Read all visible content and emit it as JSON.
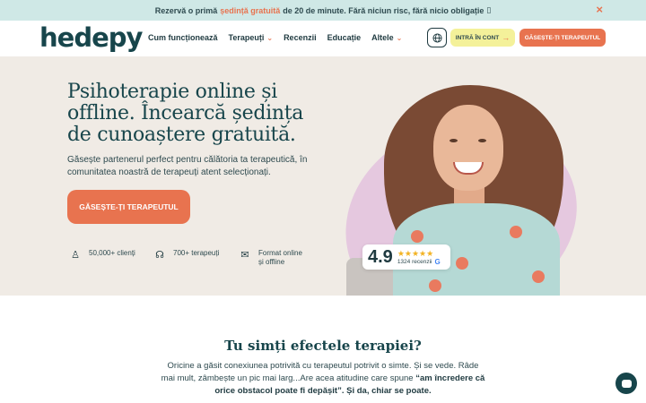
{
  "promo": {
    "text_before": "Rezervă o primă",
    "highlight": "ședință gratuită",
    "text_after": "de 20 de minute. Fără niciun risc, fără nicio obligație",
    "trailing_glyph": "▯",
    "close_symbol": "×"
  },
  "header": {
    "logo": "hedepy",
    "nav": [
      {
        "label": "Cum funcționează",
        "has_dropdown": false
      },
      {
        "label": "Terapeuți",
        "has_dropdown": true
      },
      {
        "label": "Recenzii",
        "has_dropdown": false
      },
      {
        "label": "Educație",
        "has_dropdown": false
      },
      {
        "label": "Altele",
        "has_dropdown": true
      }
    ],
    "globe_icon": "globe-icon",
    "login_label": "INTRĂ ÎN CONT",
    "login_arrow": "→",
    "cta_label": "GĂSEȘTE-ȚI TERAPEUTUL"
  },
  "hero": {
    "title": "Psihoterapie online și offline. Încearcă ședința de cunoaștere gratuită.",
    "subtitle": "Găsește partenerul perfect pentru călătoria ta terapeutică, în comunitatea noastră de terapeuți atent selecționați.",
    "cta_label": "GĂSEȘTE-ȚI TERAPEUTUL",
    "stats": [
      {
        "icon": "person-icon",
        "glyph": "♙",
        "text": "50,000+ clienți"
      },
      {
        "icon": "headset-icon",
        "glyph": "☊",
        "text": "700+ terapeuți"
      },
      {
        "icon": "chat-icon",
        "glyph": "✉",
        "text": "Format online și offline"
      }
    ],
    "rating": {
      "score": "4.9",
      "stars": "★★★★★",
      "reviews": "1324 recenzii",
      "google_mark": "G"
    }
  },
  "lower": {
    "title": "Tu simți efectele terapiei?",
    "text_plain": "Oricine a găsit conexiunea potrivită cu terapeutul potrivit o simte. Și se vede. Râde mai mult, zâmbește un pic mai larg...Are acea atitudine care spune",
    "text_bold": "“am încredere că orice obstacol poate fi depășit”. Și da, chiar se poate."
  },
  "colors": {
    "accent": "#e8734f",
    "brand": "#17454b",
    "promo_bg": "#cfe8e6",
    "hero_bg": "#f0ebe5",
    "login_bg": "#f4f19a",
    "blob": "#e5c8df"
  },
  "chat_icon": "chat-bubble-icon"
}
